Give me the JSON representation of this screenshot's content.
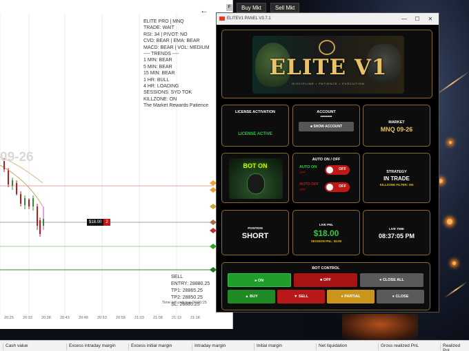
{
  "toolbar": {
    "f_label": "F",
    "buy_mkt": "Buy Mkt",
    "sell_mkt": "Sell Mkt"
  },
  "chart": {
    "info_lines": [
      "ELITE PRO | MNQ",
      "TRADE: WAIT",
      "RSI: 34 | PIVOT: NO",
      "CVD: BEAR | EMA: BEAR",
      "MACD: BEAR | VOL: MEDIUM",
      "---- TRENDS ----",
      "1 MIN: BEAR",
      "5 MIN: BEAR",
      "15 MIN: BEAR",
      "1 HR: BULL",
      "4 HR: LOADING",
      "SESSIONS: SYD TOK",
      "KILLZONE: ON",
      "The Market Rewards Patience"
    ],
    "watermark": "09-26",
    "position_price": "$18.00",
    "position_qty": "2",
    "order_lines": [
      "SELL",
      "ENTRY: 28880.25",
      "TP1: 28865.25",
      "TP2: 28850.25",
      "SL: 28885.25"
    ],
    "timer_text": "Time left until bar 00:00:25",
    "time_labels": [
      "20:25",
      "20:33",
      "20:38",
      "20:43",
      "20:48",
      "20:53",
      "20:58",
      "21:03",
      "21:08",
      "21:13",
      "21:18"
    ]
  },
  "status_bar": {
    "cells": [
      "Cash value",
      "Excess intraday margin",
      "Excess initial margin",
      "Intraday margin",
      "Initial margin",
      "Net liquidation",
      "Gross realized PnL",
      "Realized PnL"
    ]
  },
  "panel": {
    "window_title": "ELITEV1 PANEL V3.7.1",
    "brand": "ELITE V1",
    "tagline": "DISCIPLINE • PATIENCE • EXECUTION",
    "license": {
      "title": "LICENSE ACTIVATION",
      "status": "LICENSE ACTIVE"
    },
    "account": {
      "title": "ACCOUNT",
      "masked": "••••••••",
      "show_button": "■ SHOW ACCOUNT"
    },
    "market": {
      "title": "MARKET",
      "value": "MNQ 09-26"
    },
    "bot_badge": "BOT ON",
    "auto": {
      "title": "AUTO ON / OFF",
      "auto_on_label": "AUTO ON",
      "auto_on_sub": "OFF",
      "auto_off_label": "AUTO OFF",
      "auto_off_sub": "OFF",
      "toggle1": "OFF",
      "toggle2": "OFF"
    },
    "strategy": {
      "title": "STRATEGY",
      "value": "IN TRADE",
      "sub": "KILLZONE FILTER: ON"
    },
    "position": {
      "title": "POSITION",
      "value": "SHORT"
    },
    "pnl": {
      "title": "LIVE PNL",
      "value": "$18.00",
      "session": "SESSION PNL: $0.00"
    },
    "time": {
      "title": "LIVE TIME",
      "value": "08:37:05 PM"
    },
    "bot_control": {
      "title": "BOT CONTROL",
      "on": "▸ ON",
      "off": "■ OFF",
      "close_all": "● CLOSE ALL",
      "buy": "▲ BUY",
      "sell": "▼ SELL",
      "partial": "● PARTIAL",
      "close": "● CLOSE"
    },
    "colors": {
      "gold": "#8a6d2c",
      "green": "#2ecc40",
      "red": "#c01818",
      "yellow": "#e6c200"
    }
  }
}
